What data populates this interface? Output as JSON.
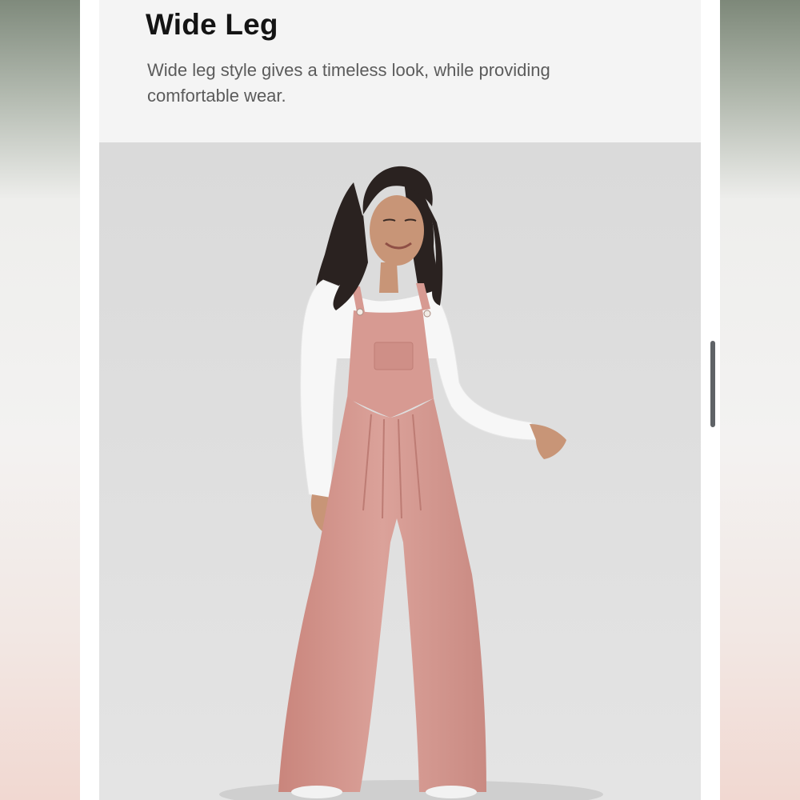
{
  "feature": {
    "title": "Wide Leg",
    "description": "Wide leg style gives a timeless look, while providing comfortable wear."
  },
  "image": {
    "subject": "model in pink overalls",
    "colors": {
      "background": "#dcdcdc",
      "overalls": "#d79a92",
      "top": "#f7f7f7",
      "hair": "#2a2220",
      "skin": "#c89577"
    }
  }
}
